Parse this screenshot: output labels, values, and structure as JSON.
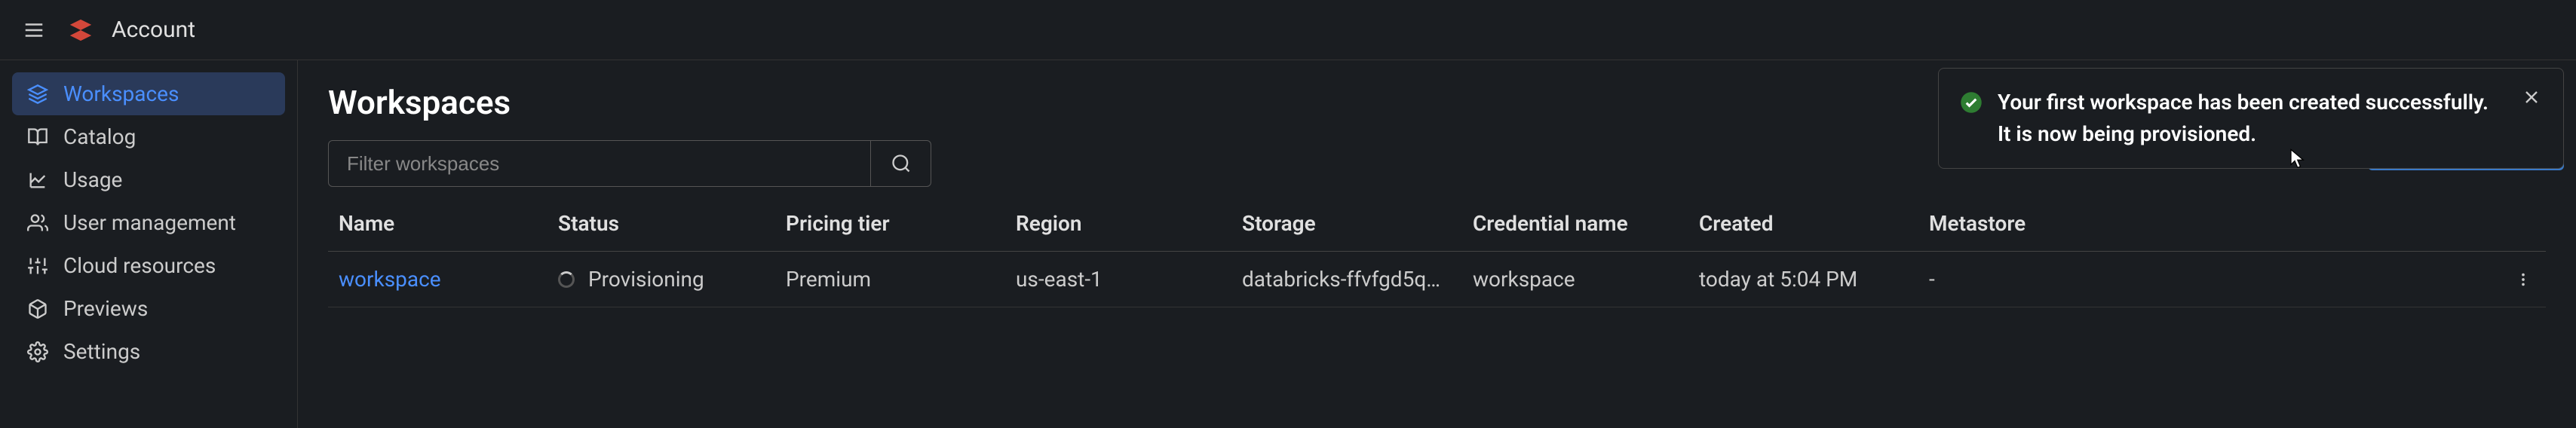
{
  "header": {
    "title": "Account"
  },
  "sidebar": {
    "items": [
      {
        "label": "Workspaces",
        "icon": "layers-icon",
        "active": true
      },
      {
        "label": "Catalog",
        "icon": "open-book-icon",
        "active": false
      },
      {
        "label": "Usage",
        "icon": "chart-icon",
        "active": false
      },
      {
        "label": "User management",
        "icon": "users-icon",
        "active": false
      },
      {
        "label": "Cloud resources",
        "icon": "sliders-icon",
        "active": false
      },
      {
        "label": "Previews",
        "icon": "cube-icon",
        "active": false
      },
      {
        "label": "Settings",
        "icon": "gear-icon",
        "active": false
      }
    ]
  },
  "page": {
    "title": "Workspaces",
    "filter_placeholder": "Filter workspaces"
  },
  "table": {
    "columns": [
      "Name",
      "Status",
      "Pricing tier",
      "Region",
      "Storage",
      "Credential name",
      "Created",
      "Metastore"
    ],
    "rows": [
      {
        "name": "workspace",
        "status": "Provisioning",
        "pricing_tier": "Premium",
        "region": "us-east-1",
        "storage": "databricks-ffvfgd5q…",
        "credential_name": "workspace",
        "created": "today at 5:04 PM",
        "metastore": "-"
      }
    ]
  },
  "toast": {
    "message": "Your first workspace has been created successfully. It is now being provisioned.",
    "type": "success"
  }
}
